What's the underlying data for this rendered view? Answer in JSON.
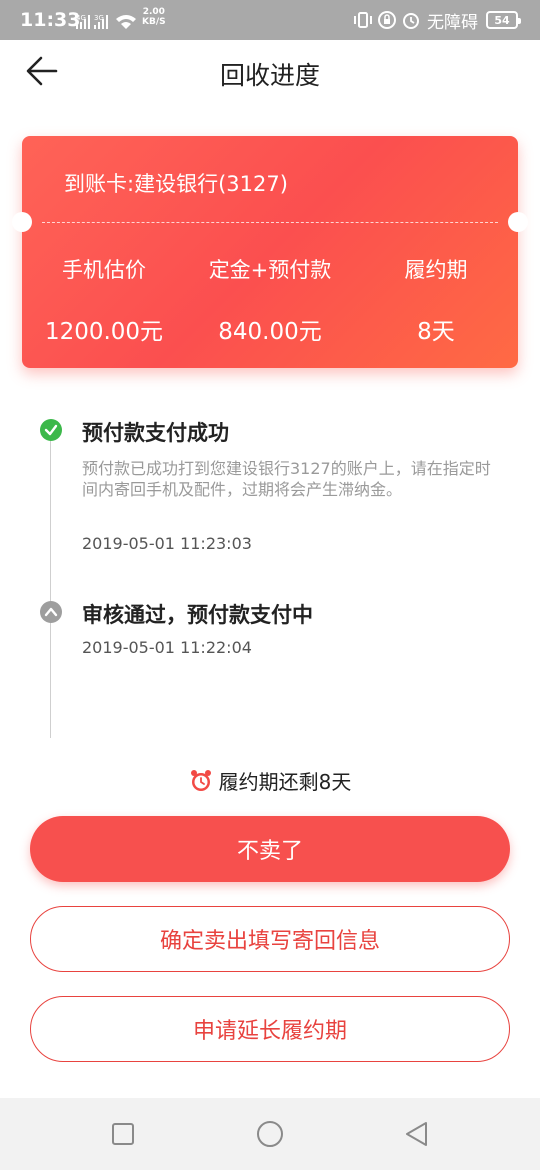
{
  "status_bar": {
    "time": "11:33",
    "net_type_1": "4G",
    "net_type_2": "3G",
    "speed_value": "2.00",
    "speed_unit": "KB/S",
    "accessibility_label": "无障碍",
    "battery": "54"
  },
  "header": {
    "title": "回收进度"
  },
  "card": {
    "bank": "到账卡:建设银行(3127)",
    "columns": [
      {
        "label": "手机估价",
        "value": "1200.00元"
      },
      {
        "label": "定金+预付款",
        "value": "840.00元"
      },
      {
        "label": "履约期",
        "value": "8天"
      }
    ]
  },
  "timeline": [
    {
      "title": "预付款支付成功",
      "desc": "预付款已成功打到您建设银行3127的账户上，请在指定时间内寄回手机及配件，过期将会产生滞纳金。",
      "time": "2019-05-01 11:23:03"
    },
    {
      "title": "审核通过，预付款支付中",
      "time": "2019-05-01 11:22:04"
    }
  ],
  "remaining": "履约期还剩8天",
  "buttons": {
    "cancel": "不卖了",
    "confirm": "确定卖出填写寄回信息",
    "extend": "申请延长履约期"
  },
  "colors": {
    "accent": "#f7504e",
    "success": "#3cb84a"
  }
}
